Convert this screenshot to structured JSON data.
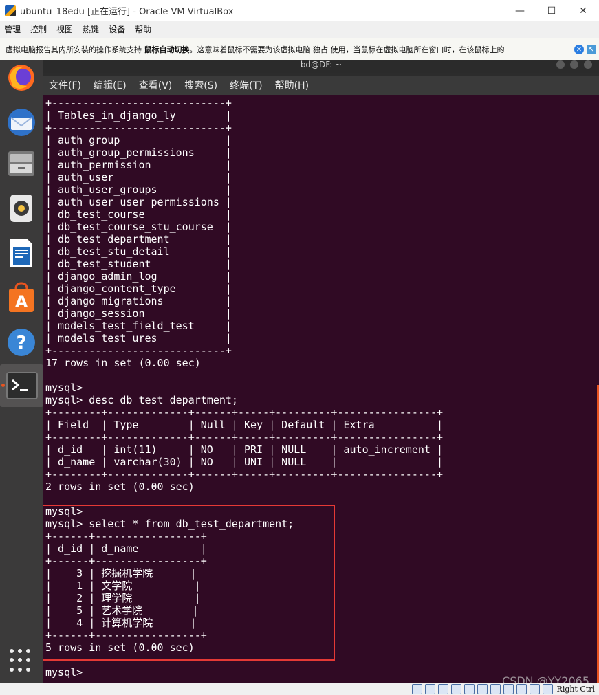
{
  "host": {
    "title": "ubuntu_18edu [正在运行] - Oracle VM VirtualBox",
    "window_controls": {
      "minimize": "—",
      "maximize": "☐",
      "close": "✕"
    },
    "menu": [
      "管理",
      "控制",
      "视图",
      "热键",
      "设备",
      "帮助"
    ],
    "notification": {
      "text_before": "虚拟电脑报告其内所安装的操作系统支持 ",
      "bold": "鼠标自动切换",
      "text_after": "。这意味着鼠标不需要为该虚拟电脑 独占 使用，当鼠标在虚拟电脑所在窗口时，在该鼠标上的"
    },
    "status": {
      "host_key": "Right Ctrl"
    }
  },
  "dock": {
    "items": [
      {
        "name": "firefox-icon"
      },
      {
        "name": "thunderbird-icon"
      },
      {
        "name": "files-icon"
      },
      {
        "name": "rhythmbox-icon"
      },
      {
        "name": "writer-icon"
      },
      {
        "name": "software-center-icon"
      },
      {
        "name": "help-icon"
      },
      {
        "name": "terminal-icon"
      }
    ]
  },
  "terminal": {
    "title": "bd@DF: ~",
    "menu": [
      "文件(F)",
      "编辑(E)",
      "查看(V)",
      "搜索(S)",
      "终端(T)",
      "帮助(H)"
    ],
    "lines": [
      "+----------------------------+",
      "| Tables_in_django_ly        |",
      "+----------------------------+",
      "| auth_group                 |",
      "| auth_group_permissions     |",
      "| auth_permission            |",
      "| auth_user                  |",
      "| auth_user_groups           |",
      "| auth_user_user_permissions |",
      "| db_test_course             |",
      "| db_test_course_stu_course  |",
      "| db_test_department         |",
      "| db_test_stu_detail         |",
      "| db_test_student            |",
      "| django_admin_log           |",
      "| django_content_type        |",
      "| django_migrations          |",
      "| django_session             |",
      "| models_test_field_test     |",
      "| models_test_ures           |",
      "+----------------------------+",
      "17 rows in set (0.00 sec)",
      "",
      "mysql>",
      "mysql> desc db_test_department;",
      "+--------+-------------+------+-----+---------+----------------+",
      "| Field  | Type        | Null | Key | Default | Extra          |",
      "+--------+-------------+------+-----+---------+----------------+",
      "| d_id   | int(11)     | NO   | PRI | NULL    | auto_increment |",
      "| d_name | varchar(30) | NO   | UNI | NULL    |                |",
      "+--------+-------------+------+-----+---------+----------------+",
      "2 rows in set (0.00 sec)",
      "",
      "mysql>",
      "mysql> select * from db_test_department;",
      "+------+-----------------+",
      "| d_id | d_name          |",
      "+------+-----------------+",
      "|    3 | 挖掘机学院      |",
      "|    1 | 文学院          |",
      "|    2 | 理学院          |",
      "|    5 | 艺术学院        |",
      "|    4 | 计算机学院      |",
      "+------+-----------------+",
      "5 rows in set (0.00 sec)",
      "",
      "mysql>"
    ],
    "watermark": "CSDN @YY2065"
  },
  "colors": {
    "terminal_bg": "#300a24",
    "highlight_border": "#e53935",
    "ubuntu_orange": "#e95420"
  }
}
